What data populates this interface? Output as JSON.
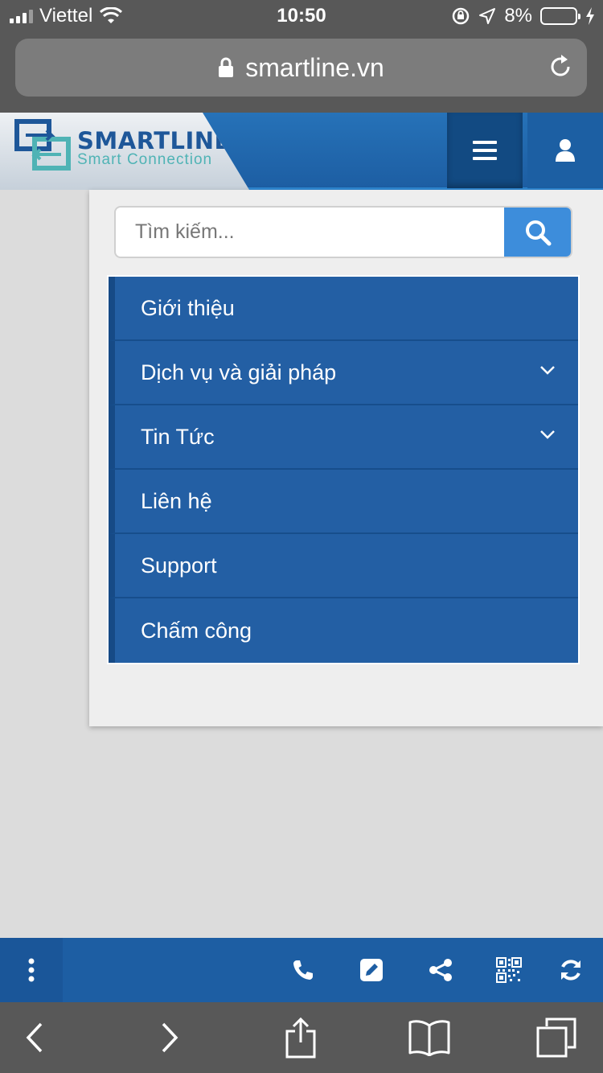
{
  "status_bar": {
    "carrier": "Viettel",
    "time": "10:50",
    "battery_text": "8%",
    "battery_level": 0.08,
    "battery_color": "#f5c400"
  },
  "browser": {
    "url": "smartline.vn",
    "icons": [
      "lock-icon",
      "reload-icon"
    ]
  },
  "header": {
    "logo_title": "SMARTLINE",
    "logo_subtitle": "Smart Connection",
    "brand_color": "#1d5ea3",
    "icons": [
      "hamburger-menu-icon",
      "user-icon"
    ]
  },
  "search": {
    "placeholder": "Tìm kiếm...",
    "icon": "search-icon"
  },
  "menu": {
    "items": [
      {
        "label": "Giới thiệu",
        "has_submenu": false
      },
      {
        "label": "Dịch vụ và giải pháp",
        "has_submenu": true
      },
      {
        "label": "Tin Tức",
        "has_submenu": true
      },
      {
        "label": "Liên hệ",
        "has_submenu": false
      },
      {
        "label": "Support",
        "has_submenu": false
      },
      {
        "label": "Chấm công",
        "has_submenu": false
      }
    ]
  },
  "site_toolbar": {
    "icons": [
      "more-vertical-icon",
      "phone-icon",
      "edit-icon",
      "share-icon",
      "qr-code-icon",
      "refresh-icon"
    ]
  },
  "safari_toolbar": {
    "icons": [
      "back-icon",
      "forward-icon",
      "share-icon",
      "bookmarks-icon",
      "tabs-icon"
    ]
  }
}
